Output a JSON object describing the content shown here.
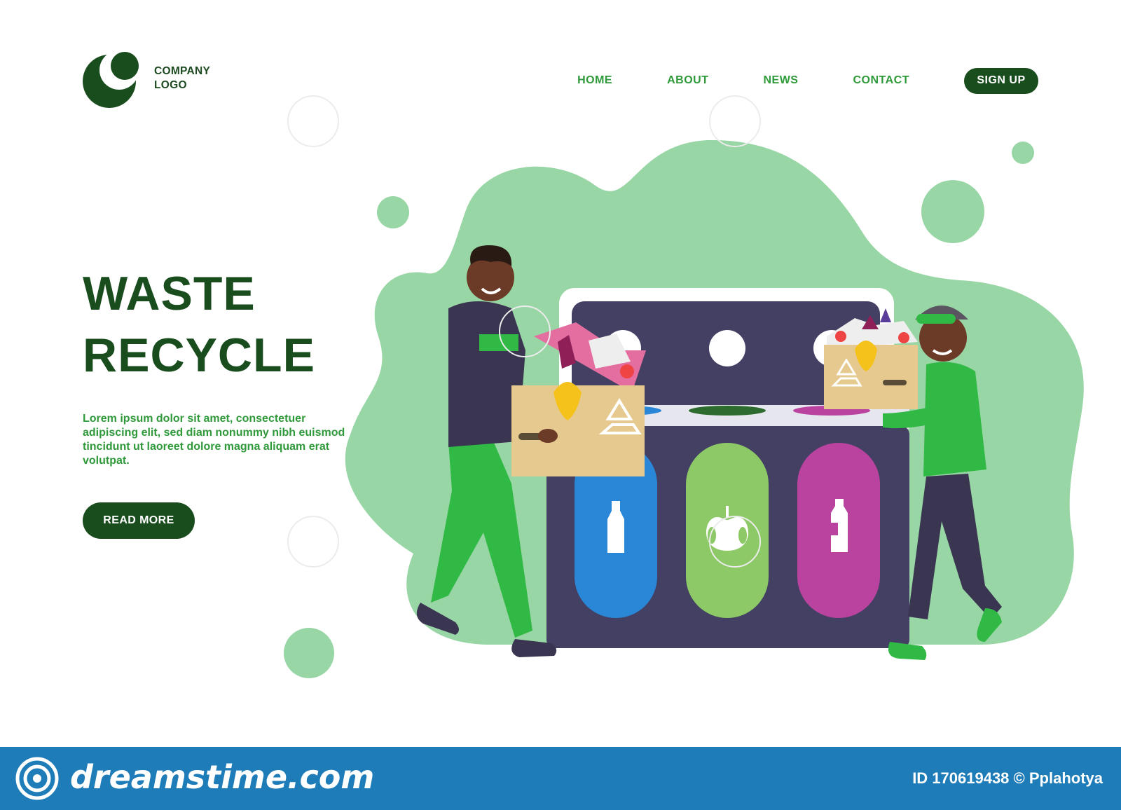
{
  "header": {
    "logo_text_line1": "COMPANY",
    "logo_text_line2": "LOGO",
    "nav": [
      {
        "label": "HOME"
      },
      {
        "label": "ABOUT"
      },
      {
        "label": "NEWS"
      },
      {
        "label": "CONTACT"
      }
    ],
    "signup_label": "SIGN UP"
  },
  "hero": {
    "title_line1": "WASTE",
    "title_line2": "RECYCLE",
    "body": "Lorem ipsum dolor sit amet, consectetuer adipiscing elit, sed diam nonummy nibh euismod tincidunt ut laoreet dolore magna aliquam erat volutpat.",
    "cta_label": "READ MORE"
  },
  "illustration": {
    "bins": [
      {
        "name": "glass",
        "icon": "bottle-icon",
        "color": "#2a86d6"
      },
      {
        "name": "organic",
        "icon": "apple-core-icon",
        "color": "#8dc967"
      },
      {
        "name": "plastic",
        "icon": "plastic-bottle-icon",
        "color": "#b9439f"
      }
    ],
    "colors": {
      "blob": "#99d6a5",
      "bin_body": "#444063",
      "dark_green": "#1a4d1e",
      "accent_green": "#2f9a3a"
    }
  },
  "footer": {
    "site": "dreamstime.com",
    "id_text": "ID 170619438 © Pplahotya"
  }
}
